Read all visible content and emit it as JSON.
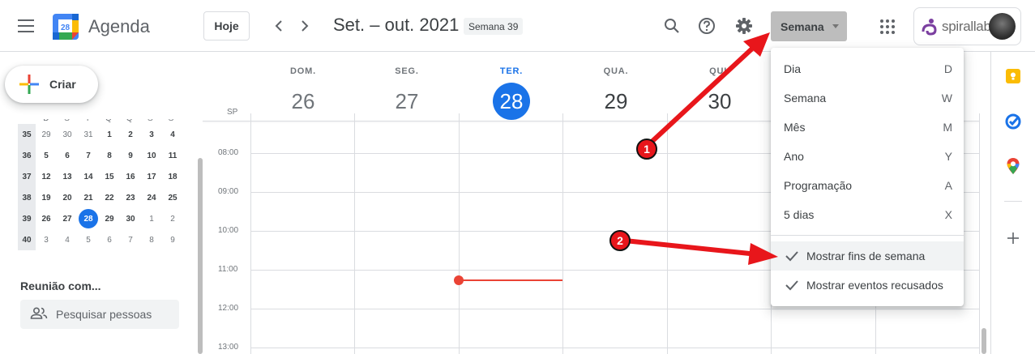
{
  "header": {
    "menu_icon": "hamburger-menu-icon",
    "logo_day": "28",
    "app_title": "Agenda",
    "today_button": "Hoje",
    "prev_icon": "chevron-left-icon",
    "next_icon": "chevron-right-icon",
    "period": "Set. – out. 2021",
    "week_badge": "Semana 39",
    "search_icon": "search-icon",
    "help_icon": "help-icon",
    "settings_icon": "gear-icon",
    "view_button": "Semana",
    "apps_icon": "apps-grid-icon",
    "brand": "spirallab"
  },
  "sidebar": {
    "create_button": "Criar",
    "mini_calendar": {
      "weekday_headers": [
        "D",
        "S",
        "T",
        "Q",
        "Q",
        "S",
        "S"
      ],
      "weeks": [
        {
          "week": "35",
          "days": [
            "29",
            "30",
            "31",
            "1",
            "2",
            "3",
            "4"
          ],
          "muted": [
            0,
            1,
            2
          ]
        },
        {
          "week": "36",
          "days": [
            "5",
            "6",
            "7",
            "8",
            "9",
            "10",
            "11"
          ],
          "muted": []
        },
        {
          "week": "37",
          "days": [
            "12",
            "13",
            "14",
            "15",
            "16",
            "17",
            "18"
          ],
          "muted": []
        },
        {
          "week": "38",
          "days": [
            "19",
            "20",
            "21",
            "22",
            "23",
            "24",
            "25"
          ],
          "muted": []
        },
        {
          "week": "39",
          "days": [
            "26",
            "27",
            "28",
            "29",
            "30",
            "1",
            "2"
          ],
          "muted": [
            5,
            6
          ],
          "today": 2
        },
        {
          "week": "40",
          "days": [
            "3",
            "4",
            "5",
            "6",
            "7",
            "8",
            "9"
          ],
          "muted": [
            0,
            1,
            2,
            3,
            4,
            5,
            6
          ]
        }
      ]
    },
    "meet_title": "Reunião com...",
    "search_people_placeholder": "Pesquisar pessoas"
  },
  "calendar": {
    "timezone": "SP",
    "days": [
      {
        "dow": "DOM.",
        "num": "26"
      },
      {
        "dow": "SEG.",
        "num": "27"
      },
      {
        "dow": "TER.",
        "num": "28",
        "today": true
      },
      {
        "dow": "QUA.",
        "num": "29"
      },
      {
        "dow": "QUI.",
        "num": "30"
      }
    ],
    "hours": [
      "08:00",
      "09:00",
      "10:00",
      "11:00",
      "12:00",
      "13:00"
    ]
  },
  "view_menu": {
    "items": [
      {
        "label": "Dia",
        "key": "D"
      },
      {
        "label": "Semana",
        "key": "W"
      },
      {
        "label": "Mês",
        "key": "M"
      },
      {
        "label": "Ano",
        "key": "Y"
      },
      {
        "label": "Programação",
        "key": "A"
      },
      {
        "label": "5 dias",
        "key": "X"
      }
    ],
    "options": [
      {
        "label": "Mostrar fins de semana",
        "checked": true
      },
      {
        "label": "Mostrar eventos recusados",
        "checked": true
      }
    ]
  },
  "side_panel": {
    "icons": [
      "keep-icon",
      "tasks-icon",
      "maps-icon",
      "add-icon"
    ]
  },
  "annotations": {
    "badge_1": "1",
    "badge_2": "2",
    "arrow_color": "#e8161b"
  },
  "colors": {
    "accent": "#1a73e8",
    "now_line": "#ea4335"
  }
}
